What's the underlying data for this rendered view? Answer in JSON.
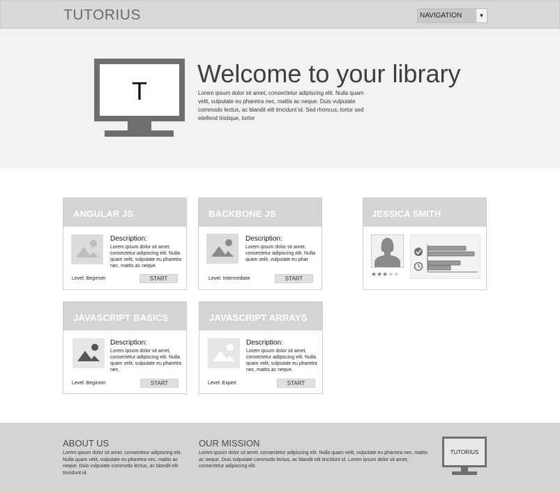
{
  "header": {
    "brand": "TUTORIUS",
    "nav_select": "NAVIGATION",
    "nav_arrow": "▼"
  },
  "hero": {
    "monitor_letter": "T",
    "title": "Welcome to your library",
    "text": "Lorem ipsum dolor sit amet, consectetur adipiscing elit. Nulla quam velit, vulputate eu pharetra nec, mattis ac neque. Duis vulputate commodo lectus, ac blandit elit tincidunt id. Sed rhoncus, tortor sed eleifend tristique, tortor"
  },
  "courses": [
    {
      "title": "ANGULAR JS",
      "desc_heading": "Description:",
      "desc": "Lorem ipsum dolor sit amet, consectetur adipiscing elit. Nulla quam velit, vulputate eu pharetra nec, mattis ac neque.",
      "level": "Level: Beginner",
      "start": "START",
      "thumb_icon": "image-icon"
    },
    {
      "title": "BACKBONE JS",
      "desc_heading": "Description:",
      "desc": "Lorem ipsum dolor sit amet, consectetur adipiscing elit. Nulla quam velit, vulputate eu phar",
      "level": "Level: Intermediate",
      "start": "START",
      "thumb_icon": "image-icon"
    },
    {
      "title": "JAVASCRIPT BASICS",
      "desc_heading": "Description:",
      "desc": "Lorem ipsum dolor sit amet, consectetur adipiscing elit. Nulla quam velit, vulputate eu pharetra nec,",
      "level": "Level: Beginner",
      "start": "START",
      "thumb_icon": "image-icon"
    },
    {
      "title": "JAVASCRIPT ARRAYS",
      "desc_heading": "Description:",
      "desc": "Lorem ipsum dolor sit amet, consectetur adipiscing elit. Nulla quam velit, vulputate eu pharetra nec, mattis ac neque.",
      "level": "Level: Expert",
      "start": "START",
      "thumb_icon": "image-icon"
    }
  ],
  "profile": {
    "name": "JESSICA SMITH",
    "avatar_icon": "user-silhouette-icon",
    "rating": 3,
    "rating_max": 5,
    "stats": [
      {
        "icon": "check-circle-icon",
        "bars": [
          0.82,
          1.0
        ]
      },
      {
        "icon": "clock-icon",
        "bars": [
          0.7,
          0.48
        ]
      }
    ]
  },
  "footer": {
    "about_title": "ABOUT US",
    "about_text": "Lorem ipsum dolor sit amet, consectetur adipiscing elit. Nulla quam velit, vulputate eu pharetra nec, mattis ac neque. Duis vulputate commodo lectus, ac blandit elit tincidunt id.",
    "mission_title": "OUR MISSION",
    "mission_text": "Lorem ipsum dolor sit amet, consectetur adipiscing elit. Nulla quam velit, vulputate eu pharetra nec, mattis ac neque. Duis vulputate commodo lectus, ac blandit elit tincidunt id. Lorem ipsum dolor sit amet, consectetur adipiscing elit.",
    "logo_text": "TUTORIUS"
  },
  "colors": {
    "header_bg": "#d9d9d9",
    "hero_bg": "#f2f2f2",
    "card_head": "#d4d4d4",
    "footer_bg": "#d4d4d4",
    "icon_gray": "#6f6f6f"
  }
}
